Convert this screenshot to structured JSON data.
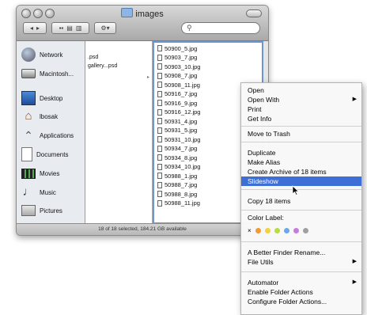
{
  "window": {
    "title": "images",
    "search_placeholder": "",
    "view_buttons": [
      "▪▪",
      "▤",
      "▥"
    ],
    "action_button": "⚙▾",
    "status": "18 of 18 selected, 184.21 GB available"
  },
  "sidebar": {
    "items": [
      {
        "label": "Network",
        "icon": "network-icon"
      },
      {
        "label": "Macintosh...",
        "icon": "hard-drive-icon"
      },
      {
        "label": "Desktop",
        "icon": "desktop-icon"
      },
      {
        "label": "lbosak",
        "icon": "home-icon"
      },
      {
        "label": "Applications",
        "icon": "applications-icon"
      },
      {
        "label": "Documents",
        "icon": "documents-icon"
      },
      {
        "label": "Movies",
        "icon": "movies-icon"
      },
      {
        "label": "Music",
        "icon": "music-icon"
      },
      {
        "label": "Pictures",
        "icon": "pictures-icon"
      }
    ]
  },
  "column1": {
    "items": [
      ".psd",
      "gallery...psd"
    ]
  },
  "column2": {
    "files": [
      "50900_5.jpg",
      "50903_7.jpg",
      "50903_10.jpg",
      "50908_7.jpg",
      "50908_11.jpg",
      "50916_7.jpg",
      "50916_9.jpg",
      "50916_12.jpg",
      "50931_4.jpg",
      "50931_5.jpg",
      "50931_10.jpg",
      "50934_7.jpg",
      "50934_8.jpg",
      "50934_10.jpg",
      "50988_1.jpg",
      "50988_7.jpg",
      "50988_8.jpg",
      "50988_11.jpg"
    ]
  },
  "menu": {
    "group1": [
      "Open",
      "Open With",
      "Print",
      "Get Info"
    ],
    "group2": [
      "Move to Trash"
    ],
    "group3": [
      "Duplicate",
      "Make Alias",
      "Create Archive of 18 items",
      "Slideshow"
    ],
    "group4": [
      "Copy 18 items"
    ],
    "color_label": "Color Label:",
    "color_none": "×",
    "label_colors": [
      "#f29b2f",
      "#f4d23b",
      "#b7dc3c",
      "#6aa8ec",
      "#c77be0",
      "#a0a0a0"
    ],
    "group5": [
      "A Better Finder Rename...",
      "File Utils"
    ],
    "group6": [
      "Automator",
      "Enable Folder Actions",
      "Configure Folder Actions..."
    ],
    "highlight_color": "#3d6fd6"
  }
}
